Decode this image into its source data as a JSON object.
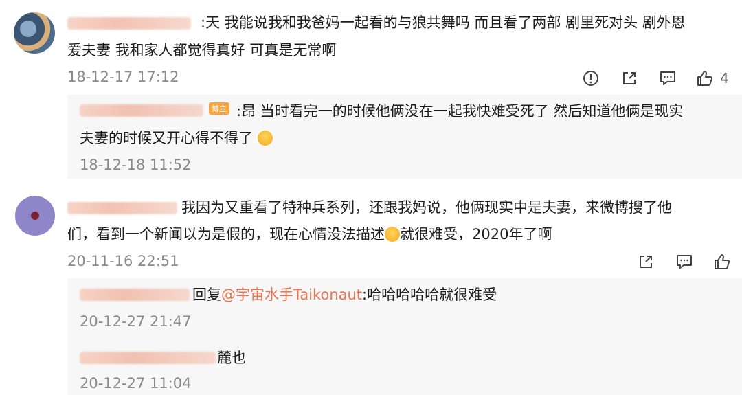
{
  "comments": [
    {
      "text_line1": ":天 我能说我和我爸妈一起看的与狼共舞吗 而且看了两部 剧里死对头 剧外恩",
      "text_line2": "爱夫妻 我和家人都觉得真好 可真是无常啊",
      "time": "18-12-17 17:12",
      "like_count": "4",
      "replies": [
        {
          "badge": "博主",
          "text_line1": ":昂 当时看完一的时候他俩没在一起我快难受死了 然后知道他俩是现实",
          "text_line2": "夫妻的时候又开心得不得了",
          "time": "18-12-18 11:52"
        }
      ]
    },
    {
      "text_line1": "我因为又重看了特种兵系列，还跟我妈说，他俩现实中是夫妻，来微博搜了他",
      "text_line2_a": "们，看到一个新闻以为是假的，现在心情没法描述",
      "text_line2_b": "就很难受，2020年了啊",
      "time": "20-11-16 22:51",
      "replies": [
        {
          "prefix": "回复",
          "mention": "@宇宙水手Taikonaut",
          "text": ":哈哈哈哈哈就很难受",
          "time": "20-12-27 21:47"
        },
        {
          "text": "麓也",
          "time": "20-12-27 11:04"
        }
      ]
    }
  ],
  "icons": [
    "report-icon",
    "share-icon",
    "comment-icon",
    "like-icon"
  ],
  "colors": {
    "accent": "#eb7350",
    "timestamp": "#8a8a8a",
    "reply_bg": "#f7f7f7"
  }
}
